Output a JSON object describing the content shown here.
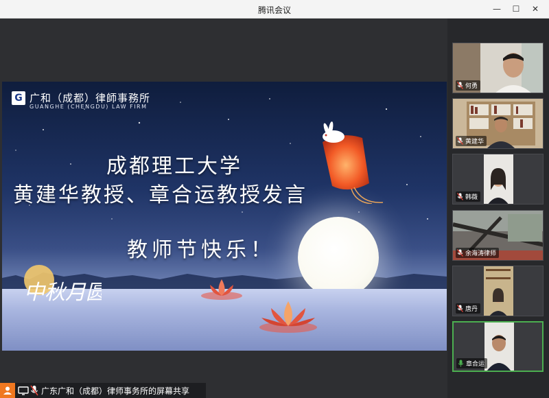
{
  "window": {
    "title": "腾讯会议",
    "minimize_glyph": "—",
    "maximize_glyph": "☐",
    "close_glyph": "✕"
  },
  "slide": {
    "firm_name_cn": "广和（成都）律師事務所",
    "firm_name_en": "GUANGHE (CHENGDU) LAW FIRM",
    "logo_glyph": "G",
    "headline_1": "成都理工大学",
    "headline_2": "黄建华教授、章合运教授发言",
    "headline_3": "教师节快乐！",
    "festival_mark": "中秋月圆"
  },
  "participants": [
    {
      "name": "何勇",
      "mic": "muted"
    },
    {
      "name": "黄建华",
      "mic": "muted"
    },
    {
      "name": "韩薇",
      "mic": "muted"
    },
    {
      "name": "余海涛律师",
      "mic": "muted"
    },
    {
      "name": "唐丹",
      "mic": "muted"
    },
    {
      "name": "章合运",
      "mic": "active"
    }
  ],
  "share_bar": {
    "text": "广东广和（成都）律师事务所的屏幕共享"
  },
  "colors": {
    "speaking_border": "#4caf50",
    "muted_mic": "#e0453a",
    "share_accent": "#f07820"
  },
  "icons": {
    "muted_mic": "mic-muted-icon",
    "active_mic": "mic-active-icon",
    "share_person": "person-icon",
    "share_screen": "screen-share-icon"
  }
}
